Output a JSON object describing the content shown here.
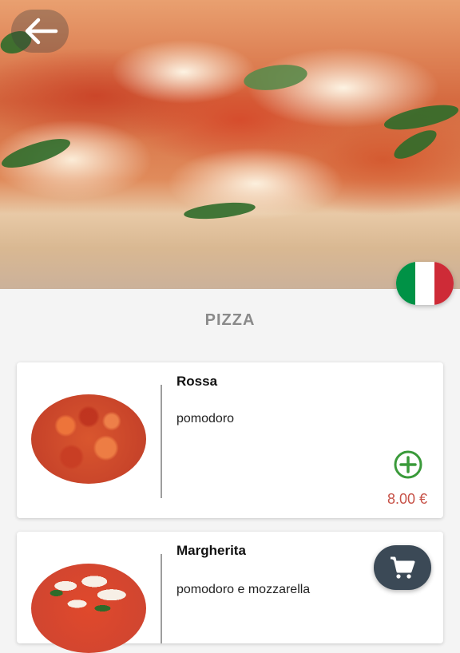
{
  "hero": {
    "image": "pizza margherita photo"
  },
  "header": {
    "back_icon": "arrow-left-icon",
    "language_flag": "italy-flag-icon"
  },
  "section": {
    "title": "PIZZA"
  },
  "products": [
    {
      "name": "Rossa",
      "description": "pomodoro",
      "price": "8.00 €",
      "image": "pizza rossa"
    },
    {
      "name": "Margherita",
      "description": "pomodoro e mozzarella",
      "image": "pizza margherita"
    }
  ],
  "cart": {
    "icon": "shopping-cart-icon"
  },
  "colors": {
    "accent_green": "#3a9a3a",
    "price_red": "#c75248",
    "fab_bg": "#3b4956",
    "flag_green": "#009246",
    "flag_white": "#ffffff",
    "flag_red": "#ce2b37"
  }
}
